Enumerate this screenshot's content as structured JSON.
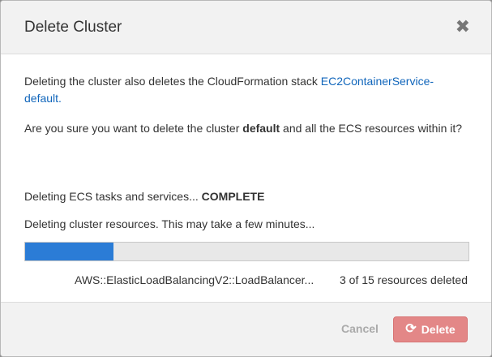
{
  "dialog": {
    "title": "Delete Cluster",
    "close_symbol": "✖",
    "close_icon": "close-icon"
  },
  "body": {
    "p1_text": "Deleting the cluster also deletes the CloudFormation stack ",
    "p1_link": "EC2ContainerService-default.",
    "p2_prefix": "Are you sure you want to delete the cluster ",
    "p2_cluster": "default",
    "p2_suffix": " and all the ECS resources within it?",
    "tasks_prefix": "Deleting ECS tasks and services... ",
    "tasks_status": "COMPLETE",
    "resources_text": "Deleting cluster resources. This may take a few minutes...",
    "progress_fraction": 0.2,
    "resource_name": "AWS::ElasticLoadBalancingV2::LoadBalancer...",
    "resource_count": "3 of 15 resources deleted"
  },
  "footer": {
    "cancel_label": "Cancel",
    "delete_label": "Delete",
    "delete_icon": "refresh-icon"
  },
  "colors": {
    "progress_fill": "#2b7cd6",
    "delete_button": "#e38787",
    "link": "#1166bb"
  }
}
